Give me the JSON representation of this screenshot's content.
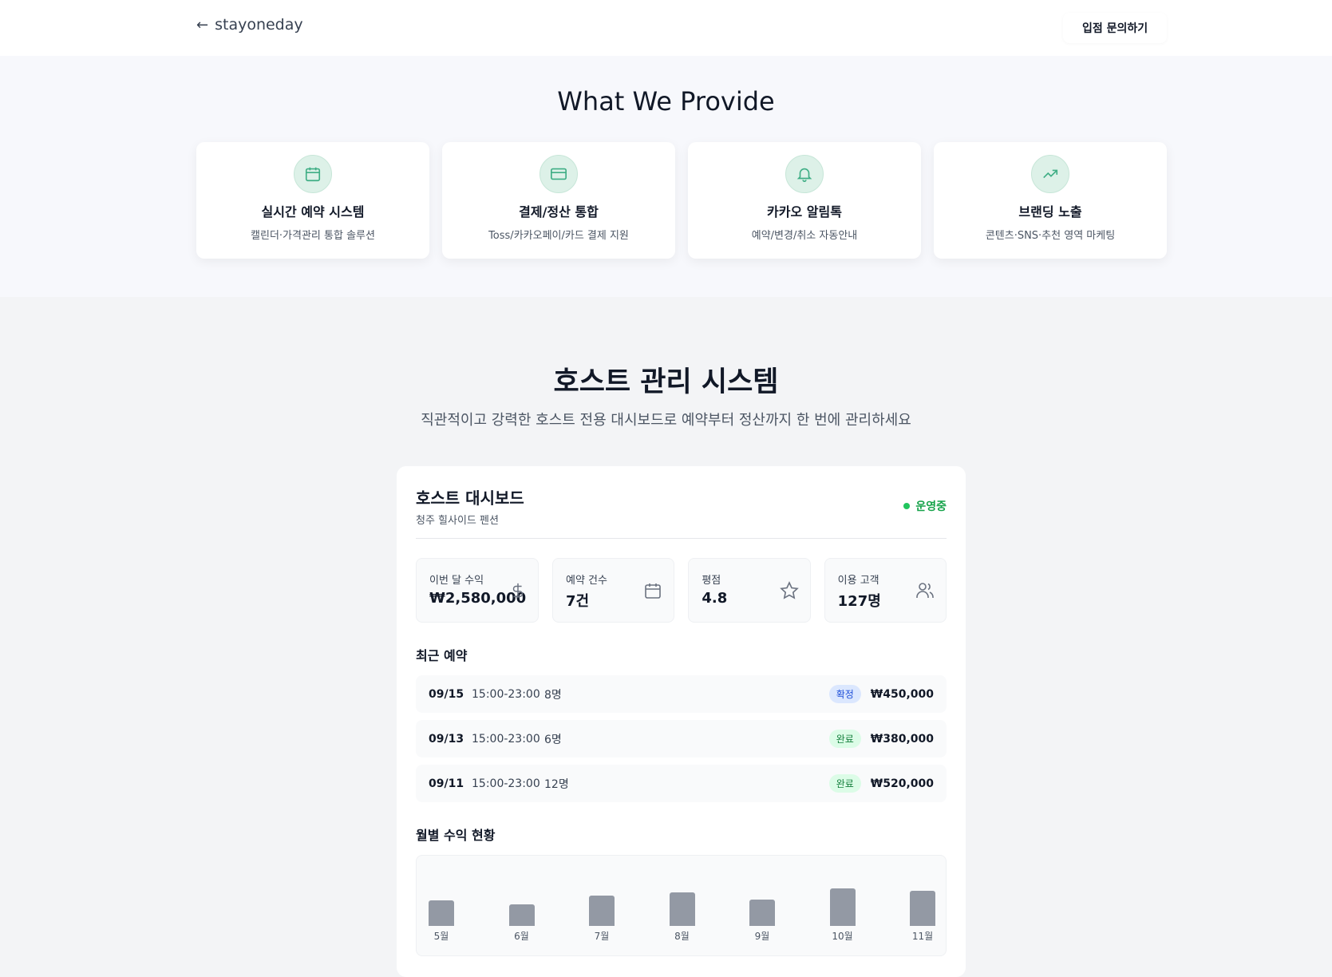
{
  "header": {
    "back_icon": "arrow-left-icon",
    "logo": "stayoneday",
    "cta": "입점 문의하기"
  },
  "provide": {
    "title": "What We Provide",
    "cards": [
      {
        "icon": "calendar-icon",
        "title": "실시간 예약 시스템",
        "desc": "캘린더·가격관리 통합 솔루션"
      },
      {
        "icon": "credit-card-icon",
        "title": "결제/정산 통합",
        "desc": "Toss/카카오페이/카드 결제 지원"
      },
      {
        "icon": "bell-icon",
        "title": "카카오 알림톡",
        "desc": "예약/변경/취소 자동안내"
      },
      {
        "icon": "trending-up-icon",
        "title": "브랜딩 노출",
        "desc": "콘텐츠·SNS·추천 영역 마케팅"
      }
    ],
    "accent": "#3fae85"
  },
  "host": {
    "title": "호스트 관리 시스템",
    "subtitle": "직관적이고 강력한 호스트 전용 대시보드로 예약부터 정산까지 한 번에 관리하세요"
  },
  "dashboard": {
    "title": "호스트 대시보드",
    "property": "청주 힐사이드 펜션",
    "status": "운영중",
    "status_color": "#16a34a",
    "stats": [
      {
        "label": "이번 달 수익",
        "value": "₩2,580,000",
        "icon": "dollar-icon"
      },
      {
        "label": "예약 건수",
        "value": "7건",
        "icon": "calendar-icon"
      },
      {
        "label": "평점",
        "value": "4.8",
        "icon": "star-icon"
      },
      {
        "label": "이용 고객",
        "value": "127명",
        "icon": "users-icon"
      }
    ],
    "recent_title": "최근 예약",
    "bookings": [
      {
        "date": "09/15",
        "time": "15:00-23:00",
        "guests": "8명",
        "status": "확정",
        "status_bg": "#dbe7fe",
        "status_fg": "#1d4ed8",
        "amount": "₩450,000"
      },
      {
        "date": "09/13",
        "time": "15:00-23:00",
        "guests": "6명",
        "status": "완료",
        "status_bg": "#dcfce7",
        "status_fg": "#15803d",
        "amount": "₩380,000"
      },
      {
        "date": "09/11",
        "time": "15:00-23:00",
        "guests": "12명",
        "status": "완료",
        "status_bg": "#dcfce7",
        "status_fg": "#15803d",
        "amount": "₩520,000"
      }
    ],
    "chart_title": "월별 수익 현황"
  },
  "chart_data": {
    "type": "bar",
    "categories": [
      "5월",
      "6월",
      "7월",
      "8월",
      "9월",
      "10월",
      "11월"
    ],
    "values_relative_pct": [
      68,
      57,
      81,
      89,
      70,
      100,
      94
    ],
    "bar_color": "#9399a4"
  }
}
